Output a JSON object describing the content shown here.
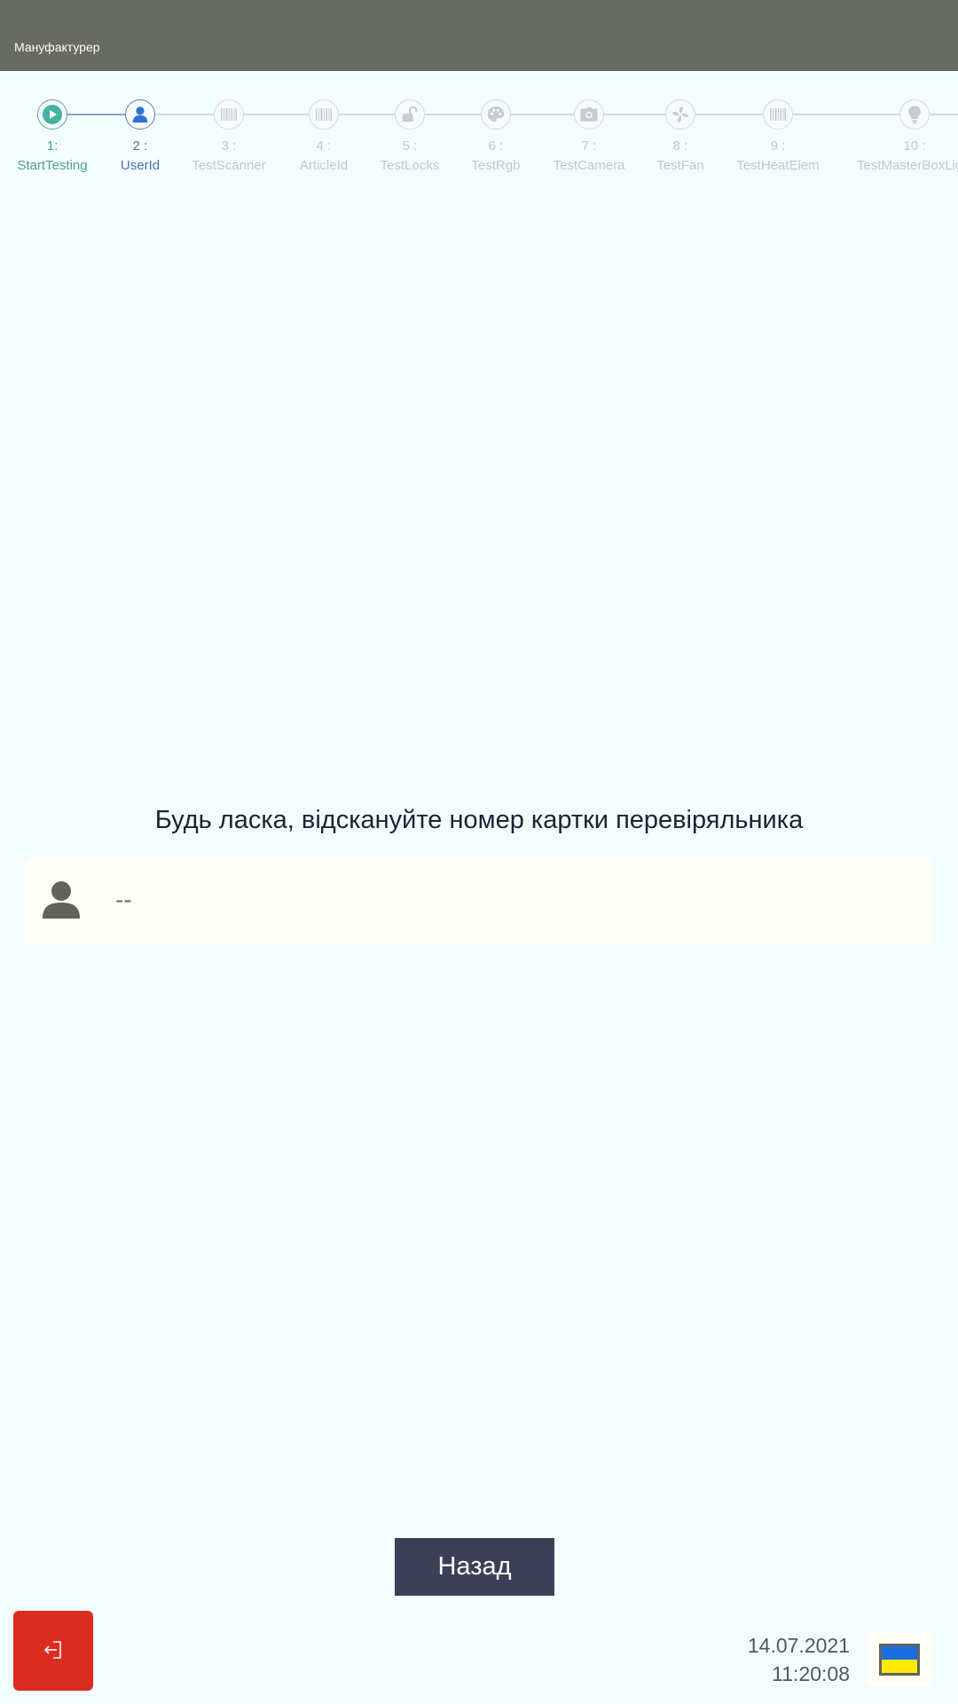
{
  "header": {
    "app_title": "Мануфактурер"
  },
  "steps": [
    {
      "number": "1:",
      "name": "StartTesting",
      "state": "done",
      "icon": "play-icon"
    },
    {
      "number": "2 :",
      "name": "UserId",
      "state": "active",
      "icon": "user-icon"
    },
    {
      "number": "3 :",
      "name": "TestScanner",
      "state": "pending",
      "icon": "barcode-icon"
    },
    {
      "number": "4 :",
      "name": "ArticleId",
      "state": "pending",
      "icon": "barcode-icon"
    },
    {
      "number": "5 :",
      "name": "TestLocks",
      "state": "pending",
      "icon": "unlock-icon"
    },
    {
      "number": "6 :",
      "name": "TestRgb",
      "state": "pending",
      "icon": "palette-icon"
    },
    {
      "number": "7 :",
      "name": "TestCamera",
      "state": "pending",
      "icon": "camera-icon"
    },
    {
      "number": "8 :",
      "name": "TestFan",
      "state": "pending",
      "icon": "fan-icon"
    },
    {
      "number": "9 :",
      "name": "TestHeatElem",
      "state": "pending",
      "icon": "barcode-icon"
    },
    {
      "number": "10 :",
      "name": "TestMasterBoxLight",
      "state": "pending",
      "icon": "lightbulb-icon"
    }
  ],
  "main": {
    "prompt": "Будь ласка, відскануйте номер картки перевіряльника",
    "scan_value": "--",
    "scan_icon": "user-icon"
  },
  "footer": {
    "back_label": "Назад",
    "exit_icon": "logout-icon",
    "date": "14.07.2021",
    "time": "11:20:08",
    "language_flag": "ukraine-flag-icon"
  },
  "colors": {
    "header_bg": "#686b5f",
    "page_bg": "#f4fdfe",
    "step_done": "#4e9f94",
    "step_active": "#4e73b3",
    "step_pending": "#c3c7c8",
    "back_button_bg": "#3b3f57",
    "exit_button_bg": "#dc2b1f",
    "flag_blue": "#1b6ce0",
    "flag_yellow": "#ffea00"
  }
}
